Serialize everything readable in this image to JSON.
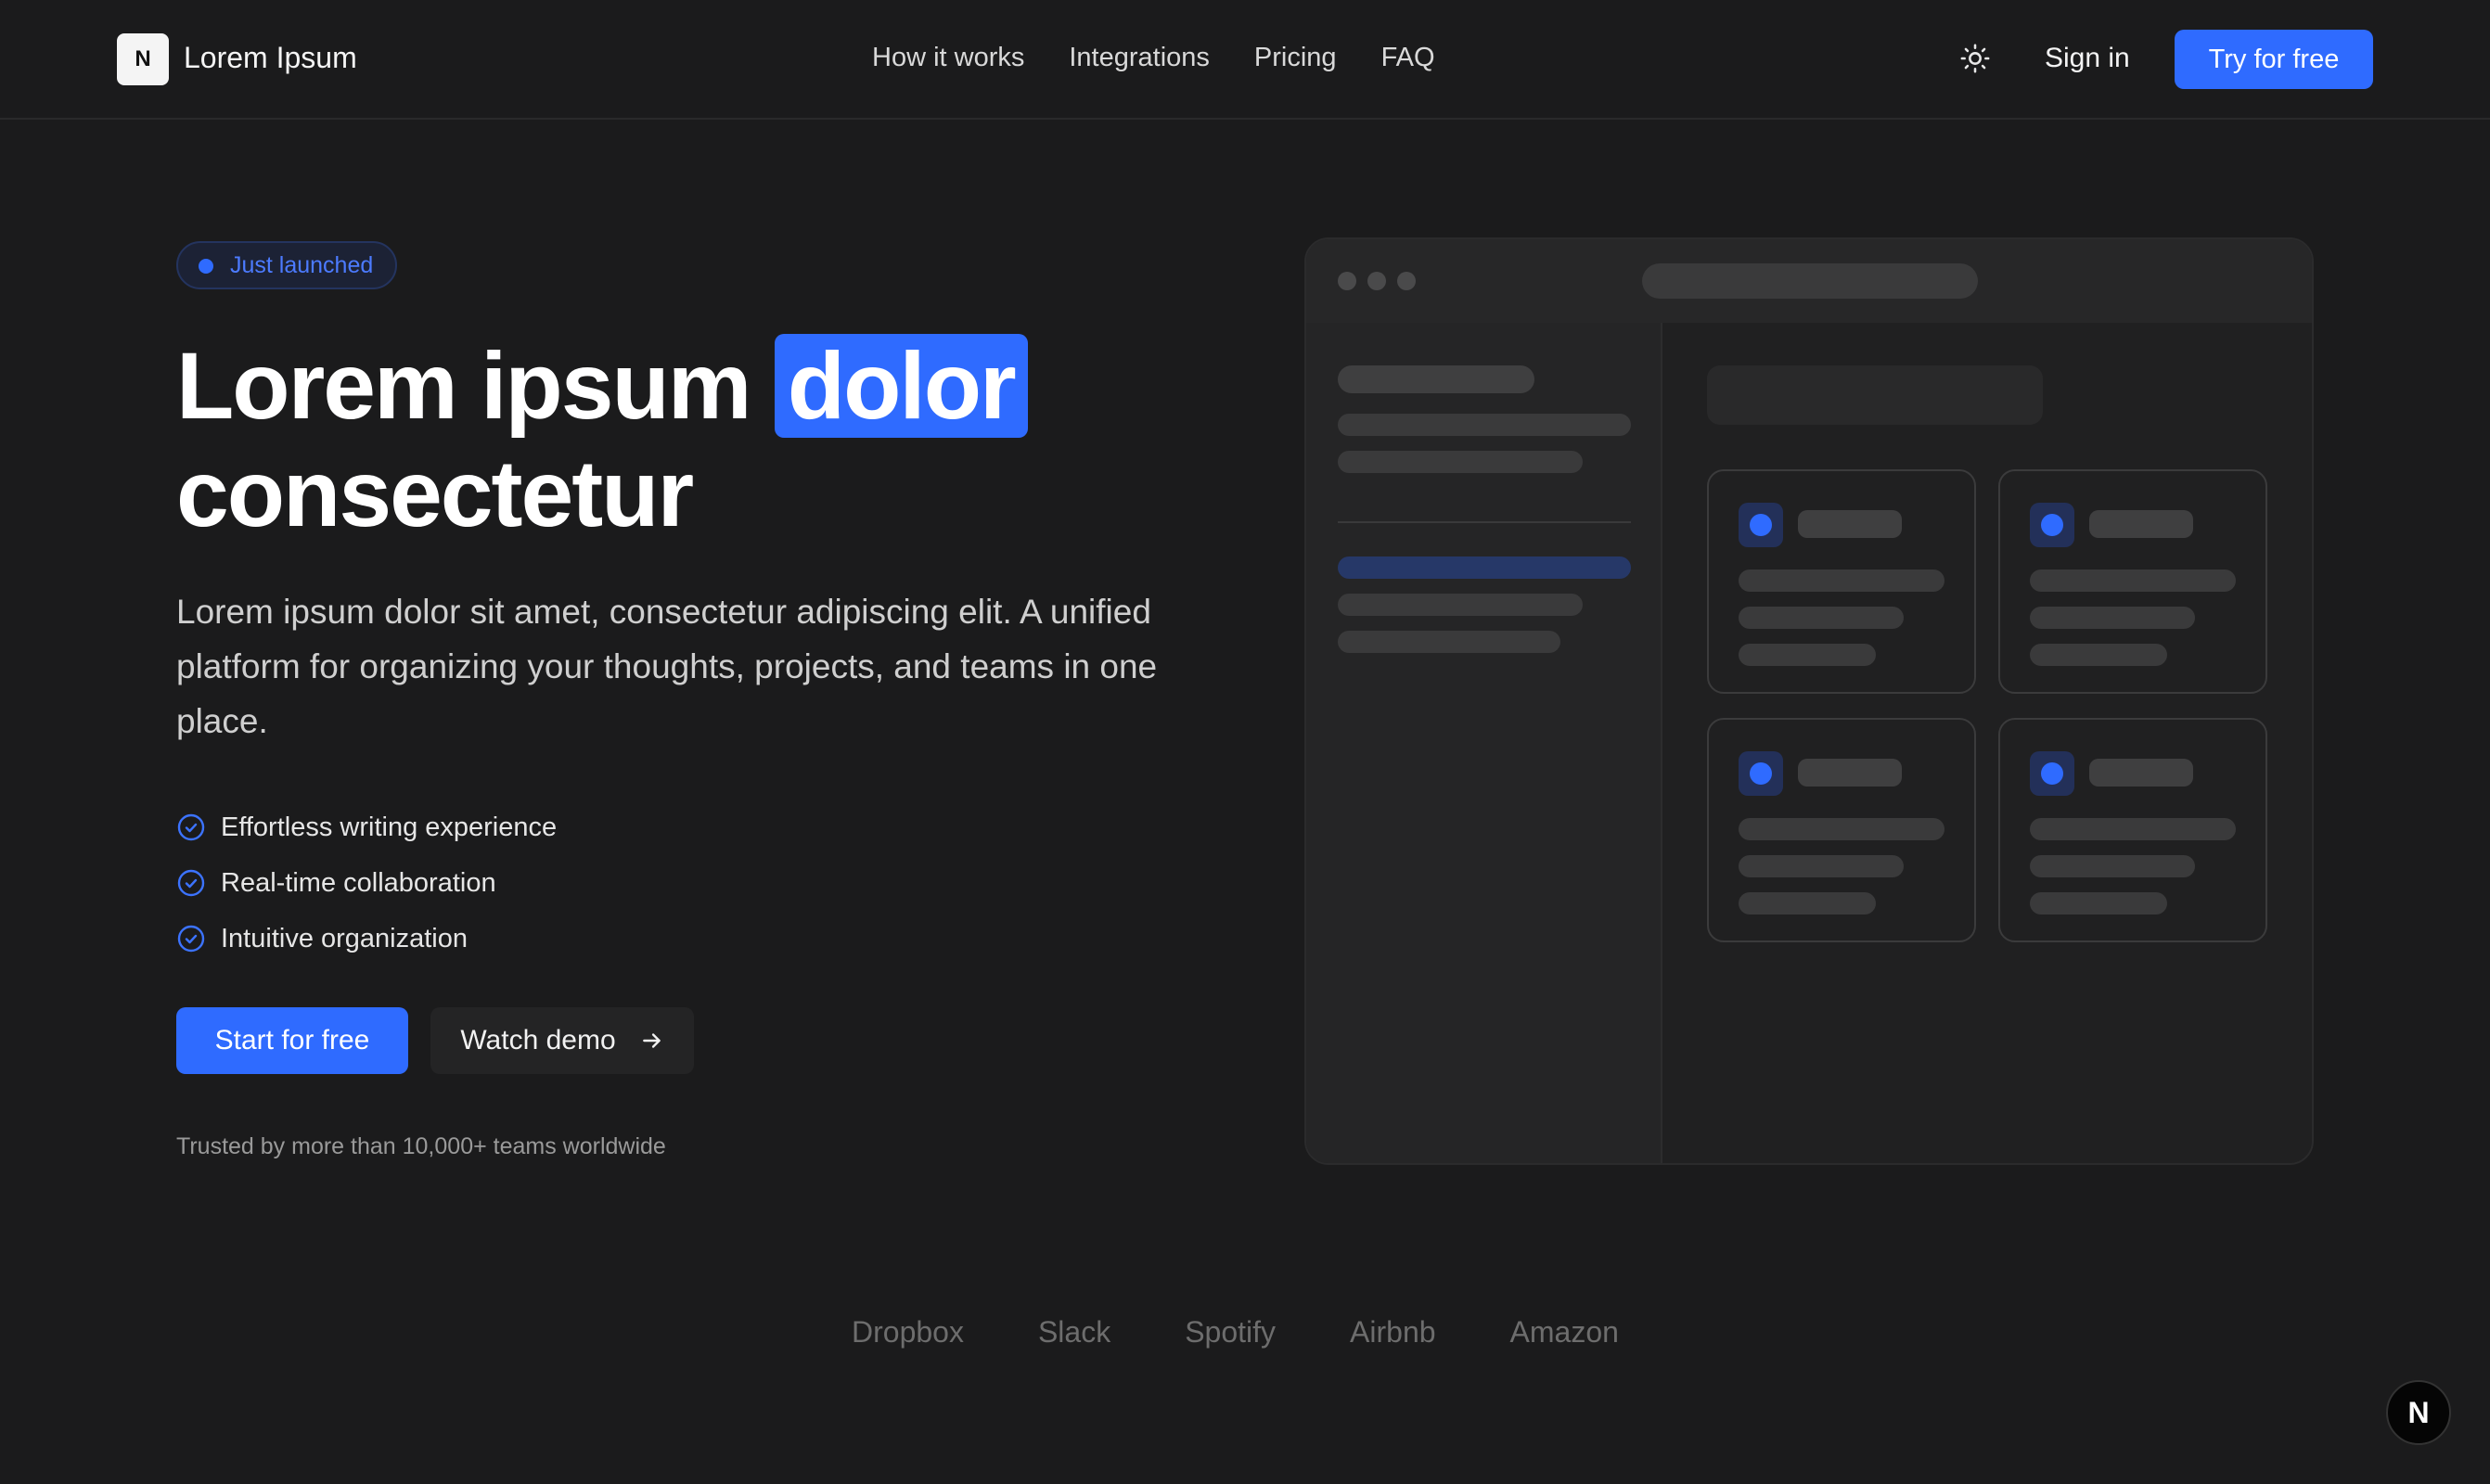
{
  "nav": {
    "logo_letter": "N",
    "logo_text": "Lorem Ipsum",
    "links": [
      "How it works",
      "Integrations",
      "Pricing",
      "FAQ"
    ],
    "theme_icon": "sun-icon",
    "signin_label": "Sign in",
    "cta_label": "Try for free"
  },
  "hero": {
    "badge": "Just launched",
    "title_part1": "Lorem ipsum ",
    "title_highlight": "dolor",
    "title_part2": "consectetur",
    "subtitle": "Lorem ipsum dolor sit amet, consectetur adipiscing elit. A unified platform for organizing your thoughts, projects, and teams in one place.",
    "features": [
      "Effortless writing experience",
      "Real-time collaboration",
      "Intuitive organization"
    ],
    "primary_button": "Start for free",
    "secondary_button": "Watch demo",
    "trusted_text": "Trusted by more than 10,000+ teams worldwide"
  },
  "brands": [
    "Dropbox",
    "Slack",
    "Spotify",
    "Airbnb",
    "Amazon"
  ],
  "corner_badge": "N",
  "colors": {
    "background": "#1b1b1c",
    "accent": "#2f6bff",
    "text": "#f2f2f2"
  }
}
